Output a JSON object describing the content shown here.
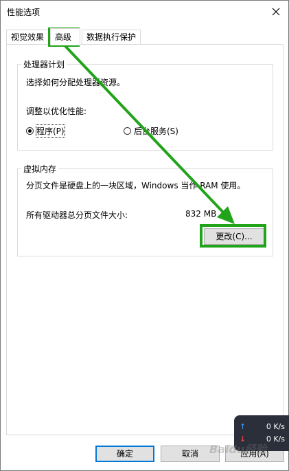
{
  "window": {
    "title": "性能选项"
  },
  "tabs": [
    {
      "label": "视觉效果"
    },
    {
      "label": "高级"
    },
    {
      "label": "数据执行保护"
    }
  ],
  "processor": {
    "legend": "处理器计划",
    "description": "选择如何分配处理器资源。",
    "adjust_label": "调整以优化性能:",
    "option_programs": "程序(P)",
    "option_services": "后台服务(S)",
    "selected": "程序(P)"
  },
  "virtual_memory": {
    "legend": "虚拟内存",
    "description": "分页文件是硬盘上的一块区域，Windows 当作 RAM 使用。",
    "total_label": "所有驱动器总分页文件大小:",
    "total_value": "832 MB",
    "change_button": "更改(C)..."
  },
  "footer": {
    "ok": "确定",
    "cancel": "取消",
    "apply": "应用(A)"
  },
  "network_widget": {
    "up": "0 K/s",
    "down": "0 K/s"
  },
  "colors": {
    "annotation_green": "#21a31a",
    "default_button_border": "#0078d7"
  }
}
